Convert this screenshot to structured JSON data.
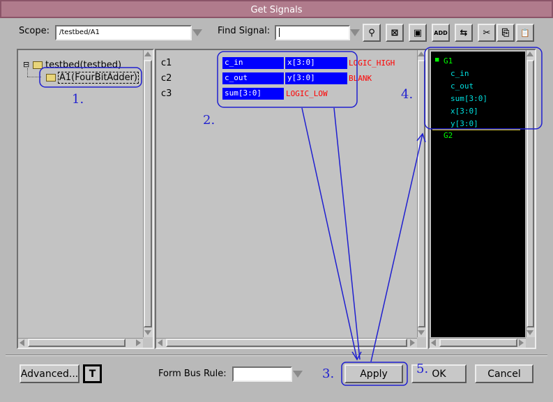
{
  "window": {
    "title": "Get Signals"
  },
  "scope": {
    "label": "Scope:",
    "value": "/testbed/A1"
  },
  "find_signal": {
    "label": "Find Signal:",
    "value": ""
  },
  "toolbar": {
    "buttons": [
      {
        "name": "find-icon",
        "glyph": "⚲"
      },
      {
        "name": "select-icon",
        "glyph": "⊠"
      },
      {
        "name": "select-all-icon",
        "glyph": "▣"
      },
      {
        "name": "add-icon",
        "glyph": "ADD"
      },
      {
        "name": "swap-icon",
        "glyph": "⇆"
      },
      {
        "name": "cut-icon",
        "glyph": "✂"
      },
      {
        "name": "copy-icon",
        "glyph": "⎘"
      },
      {
        "name": "paste-icon",
        "glyph": "📋"
      }
    ]
  },
  "tree": {
    "root": "testbed(testbed)",
    "expander": "⊟",
    "child": "A1(FourBitAdder)"
  },
  "connections": {
    "rows": [
      {
        "label": "c1",
        "left": "c_in",
        "right": "x[3:0]",
        "value": "LOGIC_HIGH"
      },
      {
        "label": "c2",
        "left": "c_out",
        "right": "y[3:0]",
        "value": "BLANK"
      },
      {
        "label": "c3",
        "left": "sum[3:0]",
        "right": "",
        "value": "LOGIC_LOW"
      }
    ]
  },
  "groups": {
    "g1": {
      "name": "G1",
      "marker": "■",
      "signals": [
        "c_in",
        "c_out",
        "sum[3:0]",
        "x[3:0]",
        "y[3:0]"
      ]
    },
    "g2": {
      "name": "G2"
    }
  },
  "bottom": {
    "advanced_label": "Advanced...",
    "t_label": "T",
    "form_bus_rule_label": "Form Bus Rule:",
    "form_bus_rule_value": "",
    "apply_label": "Apply",
    "ok_label": "OK",
    "cancel_label": "Cancel"
  },
  "annotations": {
    "n1": "1.",
    "n2": "2.",
    "n3": "3.",
    "n4": "4.",
    "n5": "5."
  },
  "colors": {
    "title_bar": "#b07b8c",
    "cell_blue": "#0000ff",
    "annotation_blue": "#1f1fd0",
    "group_green": "#00ff00",
    "signal_cyan": "#00e0e0",
    "value_red": "#ff0000"
  }
}
